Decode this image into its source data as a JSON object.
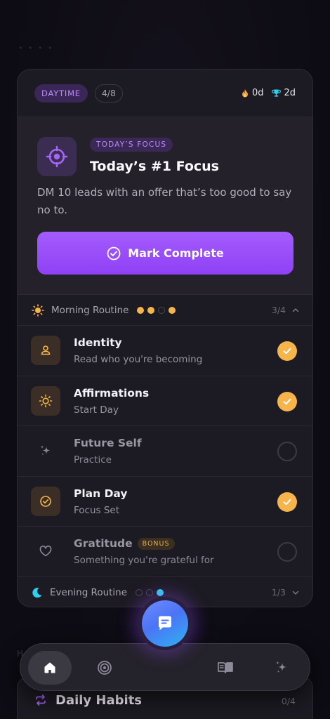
{
  "background_hint": "• • • •",
  "header": {
    "period": "DAYTIME",
    "progress": "4/8",
    "streak_current": "0d",
    "streak_best": "2d"
  },
  "focus": {
    "tag": "TODAY’S FOCUS",
    "title": "Today’s #1 Focus",
    "description": "DM 10 leads with an offer that’s too good to say no to.",
    "button_label": "Mark Complete"
  },
  "morning": {
    "label": "Morning Routine",
    "ratio": "3/4",
    "dots": [
      true,
      true,
      false,
      true
    ],
    "expanded": true
  },
  "tasks": [
    {
      "name": "Identity",
      "subtitle": "Read who you're becoming",
      "done": true,
      "icon": "person-icon"
    },
    {
      "name": "Affirmations",
      "subtitle": "Start Day",
      "done": true,
      "icon": "sun-icon"
    },
    {
      "name": "Future Self",
      "subtitle": "Practice",
      "done": false,
      "icon": "sparkle-icon"
    },
    {
      "name": "Plan Day",
      "subtitle": "Focus Set",
      "done": true,
      "icon": "check-circle-icon"
    },
    {
      "name": "Gratitude",
      "subtitle": "Something you're grateful for",
      "done": false,
      "icon": "heart-icon",
      "badge": "BONUS"
    }
  ],
  "evening": {
    "label": "Evening Routine",
    "ratio": "1/3",
    "dots": [
      false,
      false,
      true
    ],
    "expanded": false
  },
  "section_hint": "H",
  "habits": {
    "title": "Daily Habits",
    "count": "0/4"
  },
  "nav": {
    "items": [
      "home-icon",
      "target-icon",
      "chat-icon",
      "book-icon",
      "sparkle-icon"
    ],
    "active": "home-icon"
  },
  "colors": {
    "accent_purple": "#9b52fa",
    "accent_gold": "#f6b54a",
    "accent_cyan": "#2ed0f0",
    "card_bg": "#1c1a22"
  }
}
